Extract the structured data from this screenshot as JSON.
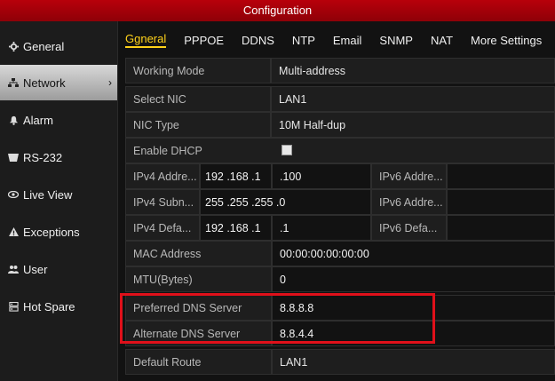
{
  "window": {
    "title": "Configuration"
  },
  "sidebar": {
    "items": [
      {
        "label": "General",
        "icon": "gear-icon"
      },
      {
        "label": "Network",
        "icon": "network-icon",
        "active": true
      },
      {
        "label": "Alarm",
        "icon": "alarm-icon"
      },
      {
        "label": "RS-232",
        "icon": "serial-icon"
      },
      {
        "label": "Live View",
        "icon": "eye-icon"
      },
      {
        "label": "Exceptions",
        "icon": "warning-icon"
      },
      {
        "label": "User",
        "icon": "users-icon"
      },
      {
        "label": "Hot Spare",
        "icon": "server-icon"
      }
    ],
    "chevron": "›"
  },
  "tabs": [
    "Ggneral",
    "PPPOE",
    "DDNS",
    "NTP",
    "Email",
    "SNMP",
    "NAT",
    "More Settings"
  ],
  "form": {
    "working_mode": {
      "label": "Working Mode",
      "value": "Multi-address"
    },
    "select_nic": {
      "label": "Select NIC",
      "value": "LAN1"
    },
    "nic_type": {
      "label": "NIC Type",
      "value": "10M Half-dup"
    },
    "enable_dhcp": {
      "label": "Enable DHCP",
      "checked": false
    },
    "ipv4_address": {
      "label": "IPv4 Addre...",
      "value": "192 .168 .1",
      "value2": ".100"
    },
    "ipv6_address1": {
      "label": "IPv6 Addre..."
    },
    "ipv4_subnet": {
      "label": "IPv4 Subn...",
      "value": "255 .255 .255 .0"
    },
    "ipv6_address2": {
      "label": "IPv6 Addre..."
    },
    "ipv4_gateway": {
      "label": "IPv4 Defa...",
      "value": "192 .168 .1",
      "value2": ".1"
    },
    "ipv6_gateway": {
      "label": "IPv6 Defa..."
    },
    "mac_address": {
      "label": "MAC Address",
      "value": "00:00:00:00:00:00"
    },
    "mtu": {
      "label": "MTU(Bytes)",
      "value": "0"
    },
    "preferred_dns": {
      "label": "Preferred DNS Server",
      "value": "8.8.8.8"
    },
    "alternate_dns": {
      "label": "Alternate DNS Server",
      "value": "8.8.4.4"
    },
    "default_route": {
      "label": "Default Route",
      "value": "LAN1"
    }
  },
  "colors": {
    "titlebar": "#a8000a",
    "active_tab": "#ffd21a",
    "highlight": "#e0101a"
  }
}
